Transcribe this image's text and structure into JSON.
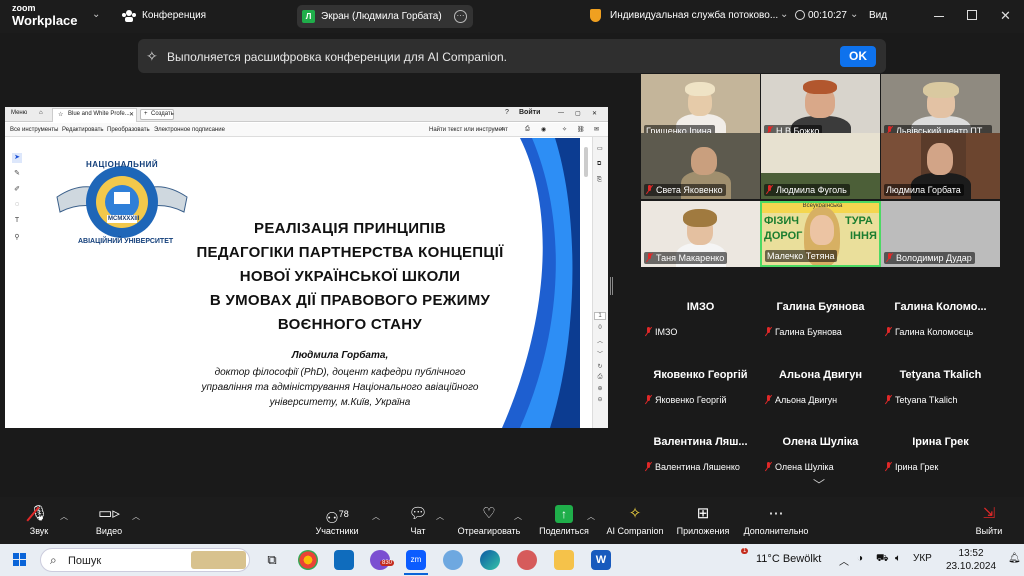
{
  "app": {
    "logo_top": "zoom",
    "logo_bottom": "Workplace",
    "conference_label": "Конференция",
    "share_label": "Экран (Людмила Горбата)",
    "service_label": "Индивидуальная служба потоково...",
    "timer": "00:10:27",
    "view_label": "Вид"
  },
  "banner": {
    "text": "Выполняется расшифровка конференции для AI Companion.",
    "ok": "OK"
  },
  "acrobat": {
    "menu": "Меню",
    "tab": "Blue and White Profe...",
    "new_tab": "Создать",
    "signin": "Войти",
    "tools": [
      "Все инструменты",
      "Редактировать",
      "Преобразовать",
      "Электронное подписание"
    ],
    "find": "Найти текст или инструмент",
    "page_num": "1",
    "page_total": "0"
  },
  "slide": {
    "logo_top": "НАЦІОНАЛЬНИЙ",
    "logo_bottom": "АВІАЦІЙНИЙ УНІВЕРСИТЕТ",
    "logo_year": "MCMXXXIII",
    "title_lines": [
      "РЕАЛІЗАЦІЯ ПРИНЦИПІВ",
      "ПЕДАГОГІКИ ПАРТНЕРСТВА КОНЦЕПЦІЇ",
      "НОВОЇ УКРАЇНСЬКОЇ ШКОЛИ",
      "В УМОВАХ ДІЇ ПРАВОВОГО РЕЖИМУ",
      "ВОЄННОГО СТАНУ"
    ],
    "author": "Людмила Горбата,",
    "desc_lines": [
      "доктор філософії (PhD), доцент кафедри публічного",
      "управління та адміністрування Національного авіаційного",
      "університету, м.Київ, Україна"
    ]
  },
  "video_tiles": [
    {
      "name": "Грищенко Ірина",
      "muted": false
    },
    {
      "name": "Н.В.Божко",
      "muted": true
    },
    {
      "name": "Львівський центр ПТ...",
      "muted": true
    },
    {
      "name": "Света Яковенко",
      "muted": true
    },
    {
      "name": "Людмила Фуголь",
      "muted": true
    },
    {
      "name": "Людмила Горбата",
      "muted": false
    },
    {
      "name": "Таня Макаренко",
      "muted": true
    },
    {
      "name": "Малечко Тетяна",
      "muted": false
    },
    {
      "name": "Володимир Дудар",
      "muted": true
    }
  ],
  "tile_banner": [
    "Всеукраїнська",
    "ФІЗИЧ",
    "ТУРА",
    "ДОРОГ",
    "ІННЯ"
  ],
  "name_tiles": [
    {
      "big": "ІМЗО",
      "small": "ІМЗО"
    },
    {
      "big": "Галина Буянова",
      "small": "Галина Буянова"
    },
    {
      "big": "Галина  Коломо...",
      "small": "Галина Коломоєць"
    },
    {
      "big": "Яковенко Георгій",
      "small": "Яковенко Георгій"
    },
    {
      "big": "Альона Двигун",
      "small": "Альона Двигун"
    },
    {
      "big": "Tetyana Tkalich",
      "small": "Tetyana Tkalich"
    },
    {
      "big": "Валентина  Ляш...",
      "small": "Валентина Ляшенко"
    },
    {
      "big": "Олена Шуліка",
      "small": "Олена Шуліка"
    },
    {
      "big": "Ірина Грек",
      "small": "Ірина Грек"
    }
  ],
  "toolbar": {
    "audio": "Звук",
    "video": "Видео",
    "participants": "Участники",
    "participants_count": "78",
    "chat": "Чат",
    "react": "Отреагировать",
    "share": "Поделиться",
    "ai": "AI Companion",
    "apps": "Приложения",
    "more": "Дополнительно",
    "leave": "Выйти"
  },
  "taskbar": {
    "search": "Пошук",
    "badge": "830",
    "weather_badge": "1",
    "weather": "11°C  Bewölkt",
    "lang": "УКР",
    "time": "13:52",
    "date": "23.10.2024"
  },
  "colors": {
    "accent_blue": "#0e72ed",
    "share_green": "#1fae4a",
    "active_speaker": "#4cd964",
    "muted_red": "#e02828"
  }
}
